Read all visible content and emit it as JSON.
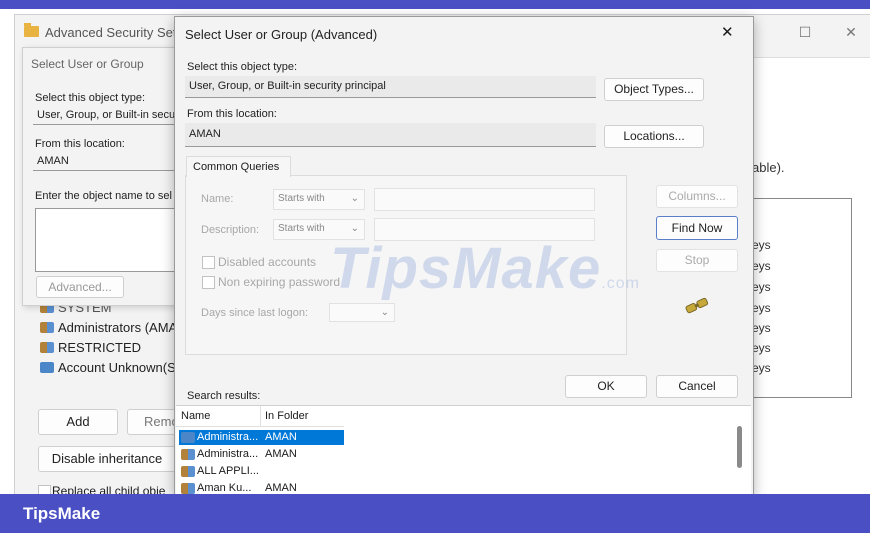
{
  "background_window": {
    "title": "Advanced Security Sett",
    "minimize": "—",
    "maximize": "☐",
    "close": "✕",
    "able_text": "able).",
    "ys_rows": [
      "eys",
      "eys",
      "eys",
      "eys",
      "eys",
      "eys",
      "eys"
    ],
    "principals": [
      {
        "label": "SYSTEM",
        "icon": "group-icon"
      },
      {
        "label": "Administrators (AMA",
        "icon": "group-icon"
      },
      {
        "label": "RESTRICTED",
        "icon": "group-icon"
      },
      {
        "label": "Account Unknown(S-",
        "icon": "unknown-account-icon"
      }
    ],
    "add_button": "Add",
    "remove_button": "Remo",
    "disable_inheritance_button": "Disable inheritance",
    "replace_checkbox_label": "Replace all child obje"
  },
  "middle_dialog": {
    "title": "Select User or Group",
    "object_type_label": "Select this object type:",
    "object_type_value": "User, Group, or Built-in secu",
    "location_label": "From this location:",
    "location_value": "AMAN",
    "enter_name_label": "Enter the object name to sel",
    "advanced_button": "Advanced..."
  },
  "dialog": {
    "title": "Select User or Group (Advanced)",
    "close": "✕",
    "object_type_label": "Select this object type:",
    "object_type_value": "User, Group, or Built-in security principal",
    "object_types_button": "Object Types...",
    "location_label": "From this location:",
    "location_value": "AMAN",
    "locations_button": "Locations...",
    "common_queries_tab": "Common Queries",
    "name_label": "Name:",
    "name_mode": "Starts with",
    "description_label": "Description:",
    "description_mode": "Starts with",
    "disabled_accounts": "Disabled accounts",
    "non_expiring_password": "Non expiring password",
    "days_since_logon": "Days since last logon:",
    "columns_button": "Columns...",
    "find_now_button": "Find Now",
    "stop_button": "Stop",
    "ok_button": "OK",
    "cancel_button": "Cancel",
    "search_results_label": "Search results:",
    "columns": [
      "Name",
      "In Folder"
    ],
    "results": [
      {
        "name": "Administra...",
        "folder": "AMAN",
        "selected": true
      },
      {
        "name": "Administra...",
        "folder": "AMAN",
        "selected": false
      },
      {
        "name": "ALL APPLI...",
        "folder": "",
        "selected": false
      },
      {
        "name": "Aman Ku...",
        "folder": "AMAN",
        "selected": false
      }
    ]
  },
  "watermark": {
    "text": "TipsMake",
    "suffix": ".com"
  },
  "footer": {
    "brand": "TipsMake"
  },
  "colors": {
    "accent": "#4a4fc4",
    "selection": "#0078d7"
  }
}
